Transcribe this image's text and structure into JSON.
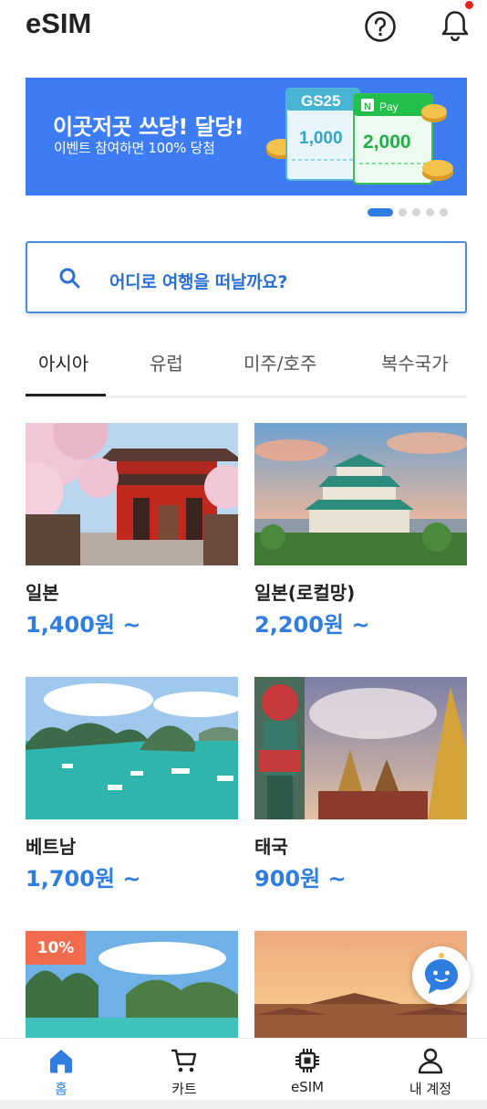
{
  "header": {
    "title": "eSIM",
    "help_icon": "question-circle-icon",
    "bell_icon": "bell-icon"
  },
  "banner": {
    "title": "이곳저곳 쓰당! 달당!",
    "subtitle": "이벤트 참여하면 100% 당첨",
    "voucher1_brand": "GS25",
    "voucher1_amount": "1,000",
    "voucher2_brand": "Pay",
    "voucher2_badge": "N",
    "voucher2_amount": "2,000",
    "page_count": 5,
    "active_page": 1
  },
  "search": {
    "placeholder": "어디로 여행을 떠날까요?"
  },
  "tabs": [
    {
      "label": "아시아",
      "active": true
    },
    {
      "label": "유럽",
      "active": false
    },
    {
      "label": "미주/호주",
      "active": false
    },
    {
      "label": "복수국가",
      "active": false
    }
  ],
  "products": [
    {
      "name": "일본",
      "price": "1,400원 ~"
    },
    {
      "name": "일본(로컬망)",
      "price": "2,200원 ~"
    },
    {
      "name": "베트남",
      "price": "1,700원 ~"
    },
    {
      "name": "태국",
      "price": "900원 ~"
    },
    {
      "name": "",
      "price": "",
      "badge": "10%"
    },
    {
      "name": "",
      "price": ""
    }
  ],
  "bottom_nav": [
    {
      "label": "홈",
      "icon": "home-icon",
      "active": true
    },
    {
      "label": "카트",
      "icon": "cart-icon",
      "active": false
    },
    {
      "label": "eSIM",
      "icon": "chip-icon",
      "active": false
    },
    {
      "label": "내 계정",
      "icon": "user-icon",
      "active": false
    }
  ],
  "colors": {
    "accent": "#2f7de1",
    "banner_bg": "#3e7cf6",
    "badge": "#f26b4c",
    "notification_dot": "#e8231f"
  }
}
